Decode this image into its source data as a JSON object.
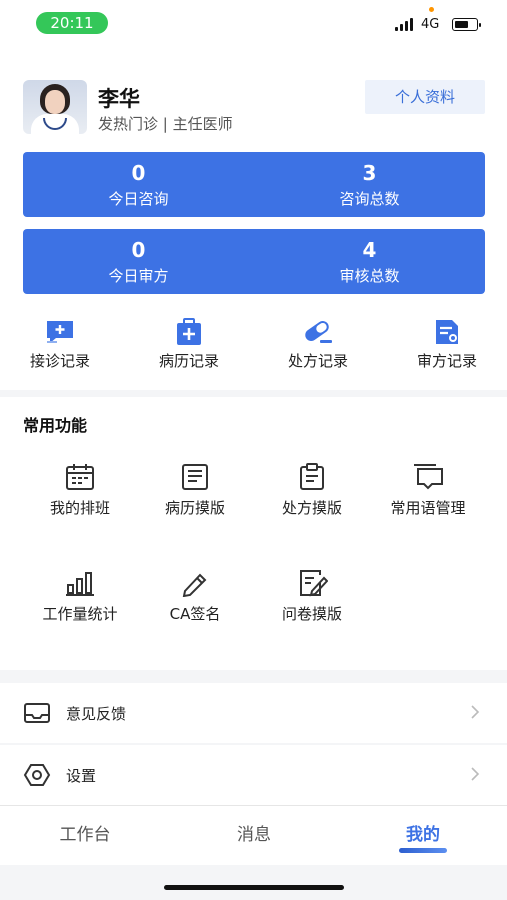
{
  "status_bar": {
    "time": "20:11",
    "network": "4G",
    "colors": {
      "time_pill": "#34c759"
    }
  },
  "profile": {
    "name": "李华",
    "department": "发热门诊 | 主任医师",
    "profile_button": "个人资料"
  },
  "stats": [
    {
      "value": "0",
      "label": "今日咨询"
    },
    {
      "value": "3",
      "label": "咨询总数"
    },
    {
      "value": "0",
      "label": "今日审方"
    },
    {
      "value": "4",
      "label": "审核总数"
    }
  ],
  "quick_actions": [
    {
      "label": "接诊记录",
      "icon": "chat-plus-icon"
    },
    {
      "label": "病历记录",
      "icon": "medical-kit-icon"
    },
    {
      "label": "处方记录",
      "icon": "capsule-icon"
    },
    {
      "label": "审方记录",
      "icon": "review-document-icon"
    }
  ],
  "features": {
    "title": "常用功能",
    "items": [
      {
        "label": "我的排班",
        "icon": "calendar-icon"
      },
      {
        "label": "病历摸版",
        "icon": "document-icon"
      },
      {
        "label": "处方摸版",
        "icon": "clipboard-icon"
      },
      {
        "label": "常用语管理",
        "icon": "message-bubble-icon"
      },
      {
        "label": "工作量统计",
        "icon": "bar-chart-icon"
      },
      {
        "label": "CA签名",
        "icon": "pen-icon"
      },
      {
        "label": "问卷摸版",
        "icon": "edit-document-icon"
      }
    ]
  },
  "menu": [
    {
      "label": "意见反馈",
      "icon": "inbox-icon"
    },
    {
      "label": "设置",
      "icon": "settings-icon"
    }
  ],
  "tabs": [
    {
      "label": "工作台"
    },
    {
      "label": "消息"
    },
    {
      "label": "我的",
      "active": true
    }
  ],
  "colors": {
    "primary": "#3d72e4",
    "profile_button_bg": "#edf2fb"
  }
}
